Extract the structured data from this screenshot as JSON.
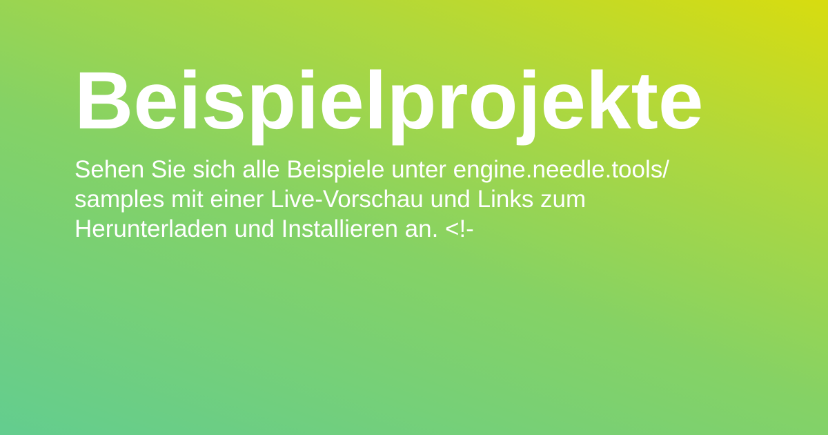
{
  "page": {
    "title": "Beispielprojekte",
    "description": "Sehen Sie sich alle Beispiele unter engine.needle.tools/ samples mit einer Live-Vorschau und Links zum Herunterladen und Installieren an. <!-"
  },
  "colors": {
    "gradient_start": "#63cd8f",
    "gradient_mid": "#85d265",
    "gradient_end": "#d8dc0f",
    "text": "#ffffff"
  }
}
